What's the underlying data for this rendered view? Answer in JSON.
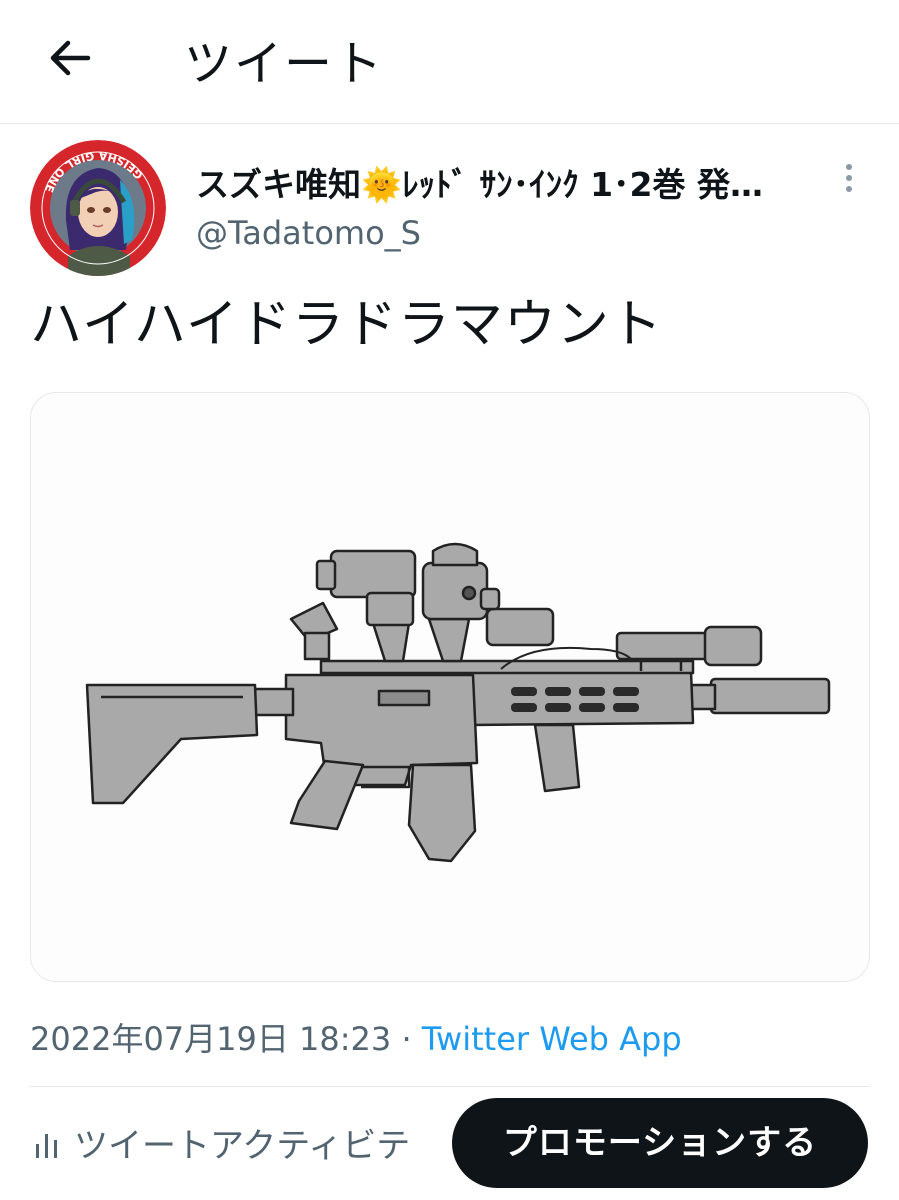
{
  "header": {
    "title": "ツイート",
    "back_icon": "arrow-left-icon"
  },
  "tweet": {
    "author": {
      "display_name": "スズキ唯知🌞ﾚｯﾄﾞ ｻﾝ･ｲﾝｸ 1･2巻 発…",
      "handle": "@Tadatomo_S",
      "avatar_ring_text": "GEISHA GIRL ONE"
    },
    "text": "ハイハイドラドラマウント",
    "media_description_icon": "rifle-illustration",
    "date": "2022年07月19日 18:23",
    "separator": "·",
    "source": "Twitter Web App"
  },
  "actions": {
    "activity_label": "ツイートアクティビテ",
    "promote_label": "プロモーションする"
  },
  "colors": {
    "link": "#1d9bf0",
    "muted": "#536471",
    "button_bg": "#0f1419",
    "avatar_ring": "#d4262b"
  }
}
